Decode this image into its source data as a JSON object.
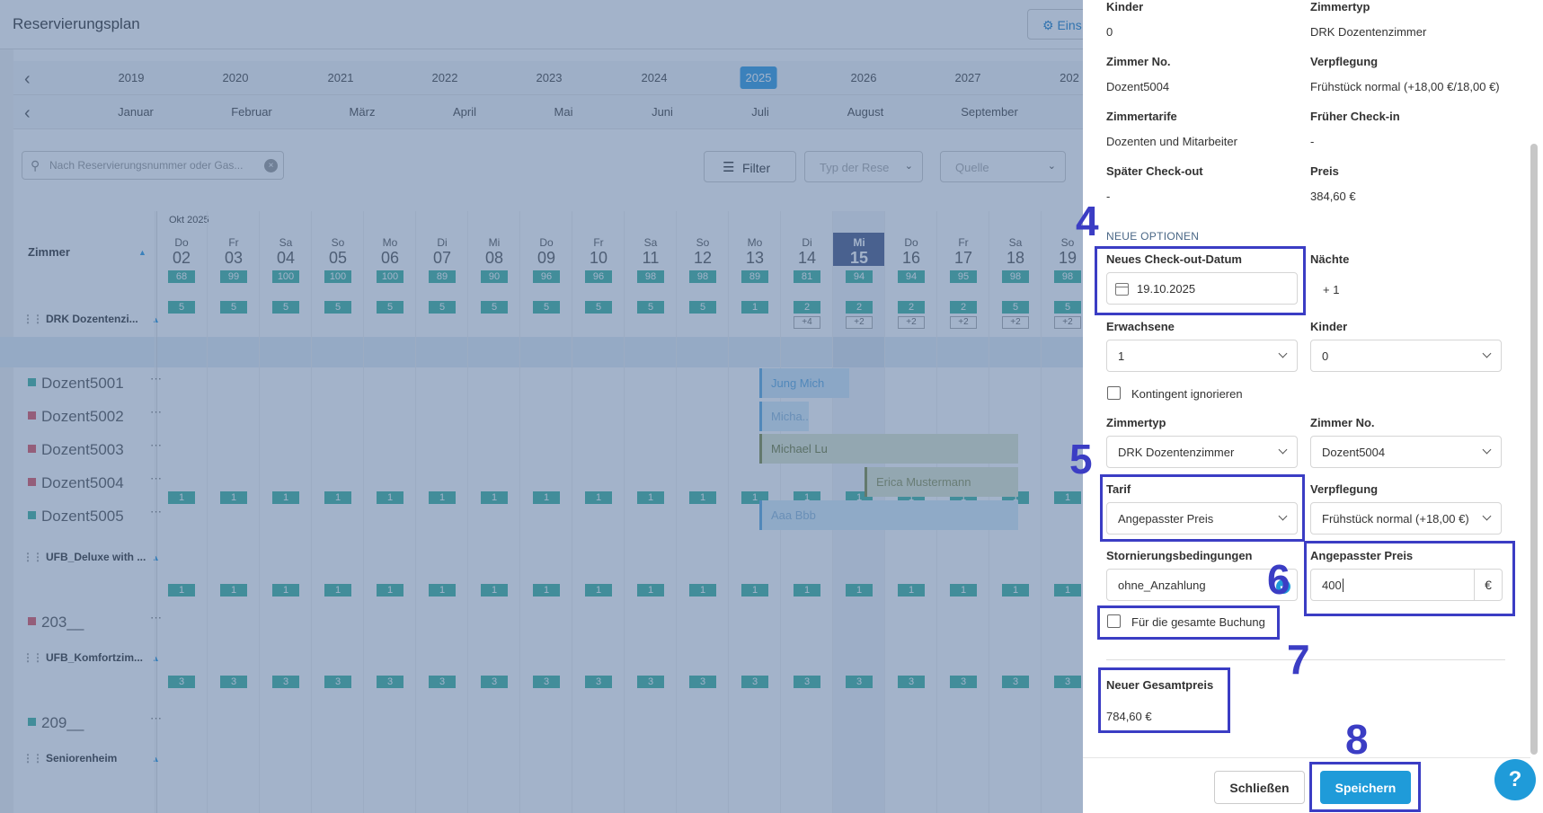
{
  "app": {
    "title": "Reservierungsplan",
    "settings_label": "Eins"
  },
  "years": [
    "2019",
    "2020",
    "2021",
    "2022",
    "2023",
    "2024",
    "2025",
    "2026",
    "2027",
    "202"
  ],
  "active_year": "2025",
  "months": [
    "Januar",
    "Februar",
    "März",
    "April",
    "Mai",
    "Juni",
    "Juli",
    "August",
    "September"
  ],
  "search": {
    "placeholder": "Nach Reservierungsnummer oder Gas..."
  },
  "filter_label": "Filter",
  "filter_selects": [
    "Typ der Rese",
    "Quelle"
  ],
  "calendar": {
    "room_header": "Zimmer",
    "month_label": "Okt 2025",
    "days": [
      {
        "dn": "Do",
        "dd": "02",
        "occ": "68"
      },
      {
        "dn": "Fr",
        "dd": "03",
        "occ": "99"
      },
      {
        "dn": "Sa",
        "dd": "04",
        "occ": "100"
      },
      {
        "dn": "So",
        "dd": "05",
        "occ": "100"
      },
      {
        "dn": "Mo",
        "dd": "06",
        "occ": "100"
      },
      {
        "dn": "Di",
        "dd": "07",
        "occ": "89"
      },
      {
        "dn": "Mi",
        "dd": "08",
        "occ": "90"
      },
      {
        "dn": "Do",
        "dd": "09",
        "occ": "96"
      },
      {
        "dn": "Fr",
        "dd": "10",
        "occ": "96"
      },
      {
        "dn": "Sa",
        "dd": "11",
        "occ": "98"
      },
      {
        "dn": "So",
        "dd": "12",
        "occ": "98"
      },
      {
        "dn": "Mo",
        "dd": "13",
        "occ": "89"
      },
      {
        "dn": "Di",
        "dd": "14",
        "occ": "81"
      },
      {
        "dn": "Mi",
        "dd": "15",
        "occ": "94"
      },
      {
        "dn": "Do",
        "dd": "16",
        "occ": "94"
      },
      {
        "dn": "Fr",
        "dd": "17",
        "occ": "95"
      },
      {
        "dn": "Sa",
        "dd": "18",
        "occ": "98"
      },
      {
        "dn": "So",
        "dd": "19",
        "occ": "98"
      }
    ],
    "today_index": 13,
    "group1_avail": [
      "5",
      "5",
      "5",
      "5",
      "5",
      "5",
      "5",
      "5",
      "5",
      "5",
      "5",
      "1",
      "2",
      "2",
      "2",
      "2",
      "5",
      "5"
    ],
    "group1_plus": [
      "",
      "",
      "",
      "",
      "",
      "",
      "",
      "",
      "",
      "",
      "",
      "",
      "+4",
      "+2",
      "+2",
      "+2",
      "+2",
      "+2"
    ],
    "group2_avail": [
      "1",
      "1",
      "1",
      "1",
      "1",
      "1",
      "1",
      "1",
      "1",
      "1",
      "1",
      "1",
      "1",
      "1",
      "1",
      "1",
      "1",
      "1"
    ],
    "group3_avail": [
      "1",
      "1",
      "1",
      "1",
      "1",
      "1",
      "1",
      "1",
      "1",
      "1",
      "1",
      "1",
      "1",
      "1",
      "1",
      "1",
      "1",
      "1"
    ],
    "group4_avail": [
      "3",
      "3",
      "3",
      "3",
      "3",
      "3",
      "3",
      "3",
      "3",
      "3",
      "3",
      "3",
      "3",
      "3",
      "3",
      "3",
      "3",
      "3"
    ],
    "groups": [
      "DRK Dozentenzi...",
      "UFB_Deluxe with ...",
      "UFB_Komfortzim...",
      "Seniorenheim"
    ],
    "rooms": [
      {
        "name": "Dozent5001",
        "color": "#3cb39e"
      },
      {
        "name": "Dozent5002",
        "color": "#e0555f"
      },
      {
        "name": "Dozent5003",
        "color": "#e0555f"
      },
      {
        "name": "Dozent5004",
        "color": "#e0555f"
      },
      {
        "name": "Dozent5005",
        "color": "#3cb39e"
      },
      {
        "name": "203__",
        "color": "#e0555f"
      },
      {
        "name": "209__",
        "color": "#3cb39e"
      }
    ],
    "bookings": [
      "Jung Mich",
      "Micha...",
      "Michael Lu",
      "Erica Mustermann",
      "Aaa Bbb"
    ]
  },
  "drawer": {
    "existing": {
      "kinder_label": "Kinder",
      "kinder_value": "0",
      "zimmertyp_label": "Zimmertyp",
      "zimmertyp_value": "DRK Dozentenzimmer",
      "zimmer_no_label": "Zimmer No.",
      "zimmer_no_value": "Dozent5004",
      "verpflegung_label": "Verpflegung",
      "verpflegung_value": "Frühstück normal (+18,00 €/18,00 €)",
      "zimmertarife_label": "Zimmertarife",
      "zimmertarife_value": "Dozenten und Mitarbeiter",
      "frueher_checkin_label": "Früher Check-in",
      "frueher_checkin_value": "-",
      "spaeter_checkout_label": "Später Check-out",
      "spaeter_checkout_value": "-",
      "preis_label": "Preis",
      "preis_value": "384,60 €"
    },
    "section_title": "NEUE OPTIONEN",
    "new_checkout_label": "Neues Check-out-Datum",
    "new_checkout_value": "19.10.2025",
    "naechte_label": "Nächte",
    "naechte_value": "+ 1",
    "erwachsene_label": "Erwachsene",
    "erwachsene_value": "1",
    "kinder_label": "Kinder",
    "kinder_value": "0",
    "kontingent_label": "Kontingent ignorieren",
    "zimmertyp_label": "Zimmertyp",
    "zimmertyp_value": "DRK Dozentenzimmer",
    "zimmer_no_label": "Zimmer No.",
    "zimmer_no_value": "Dozent5004",
    "tarif_label": "Tarif",
    "tarif_value": "Angepasster Preis",
    "verpflegung_label": "Verpflegung",
    "verpflegung_value": "Frühstück normal (+18,00 €)",
    "storno_label": "Stornierungsbedingungen",
    "storno_value": "ohne_Anzahlung",
    "angepasst_label": "Angepasster Preis",
    "angepasst_value": "400",
    "currency": "€",
    "gesamte_buchung_label": "Für die gesamte Buchung",
    "gesamtpreis_label": "Neuer Gesamtpreis",
    "gesamtpreis_value": "784,60 €",
    "close_label": "Schließen",
    "save_label": "Speichern"
  },
  "help_label": "?",
  "annotations": [
    "4",
    "5",
    "6",
    "7",
    "8"
  ]
}
